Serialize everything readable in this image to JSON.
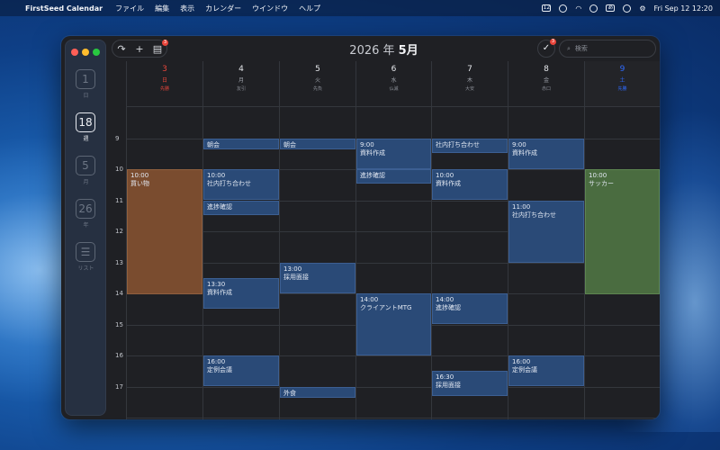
{
  "menubar": {
    "apple": "",
    "app_name": "FirstSeed Calendar",
    "menus": [
      "ファイル",
      "編集",
      "表示",
      "カレンダー",
      "ウインドウ",
      "ヘルプ"
    ],
    "calendar_icon_text": "12",
    "ime": "あ",
    "datetime": "Fri Sep 12  12:20"
  },
  "sidebar": {
    "items": [
      {
        "number": "1",
        "label": "日"
      },
      {
        "number": "18",
        "label": "週"
      },
      {
        "number": "5",
        "label": "月"
      },
      {
        "number": "26",
        "label": "年"
      },
      {
        "number": "☰",
        "label": "リスト"
      }
    ]
  },
  "toolbar": {
    "share_icon": "↷",
    "add_icon": "+",
    "inbox_badge": "3",
    "title_year": "2026 年",
    "title_month": "5月",
    "check_badge": "3",
    "check_icon": "✓",
    "search_placeholder": "検索"
  },
  "days": [
    {
      "num": "3",
      "dow": "日",
      "rokuyo": "先勝"
    },
    {
      "num": "4",
      "dow": "月",
      "rokuyo": "友引"
    },
    {
      "num": "5",
      "dow": "火",
      "rokuyo": "先負"
    },
    {
      "num": "6",
      "dow": "水",
      "rokuyo": "仏滅"
    },
    {
      "num": "7",
      "dow": "木",
      "rokuyo": "大安"
    },
    {
      "num": "8",
      "dow": "金",
      "rokuyo": "赤口"
    },
    {
      "num": "9",
      "dow": "土",
      "rokuyo": "先勝"
    }
  ],
  "hours": [
    "9",
    "10",
    "11",
    "12",
    "13",
    "14",
    "15",
    "16",
    "17"
  ],
  "events": [
    {
      "time": "10:00",
      "title": "買い物"
    },
    {
      "time": "",
      "title": "朝会"
    },
    {
      "time": "10:00",
      "title": "社内打ち合わせ"
    },
    {
      "time": "",
      "title": "進捗確認"
    },
    {
      "time": "13:30",
      "title": "資料作成"
    },
    {
      "time": "16:00",
      "title": "定例会議"
    },
    {
      "time": "",
      "title": "朝会"
    },
    {
      "time": "13:00",
      "title": "採用面接"
    },
    {
      "time": "",
      "title": "外食"
    },
    {
      "time": "9:00",
      "title": "資料作成"
    },
    {
      "time": "",
      "title": "進捗確認"
    },
    {
      "time": "14:00",
      "title": "クライアントMTG"
    },
    {
      "time": "",
      "title": "社内打ち合わせ"
    },
    {
      "time": "10:00",
      "title": "資料作成"
    },
    {
      "time": "14:00",
      "title": "進捗確認"
    },
    {
      "time": "16:30",
      "title": "採用面接"
    },
    {
      "time": "9:00",
      "title": "資料作成"
    },
    {
      "time": "11:00",
      "title": "社内打ち合わせ"
    },
    {
      "time": "16:00",
      "title": "定例会議"
    },
    {
      "time": "10:00",
      "title": "サッカー"
    }
  ]
}
